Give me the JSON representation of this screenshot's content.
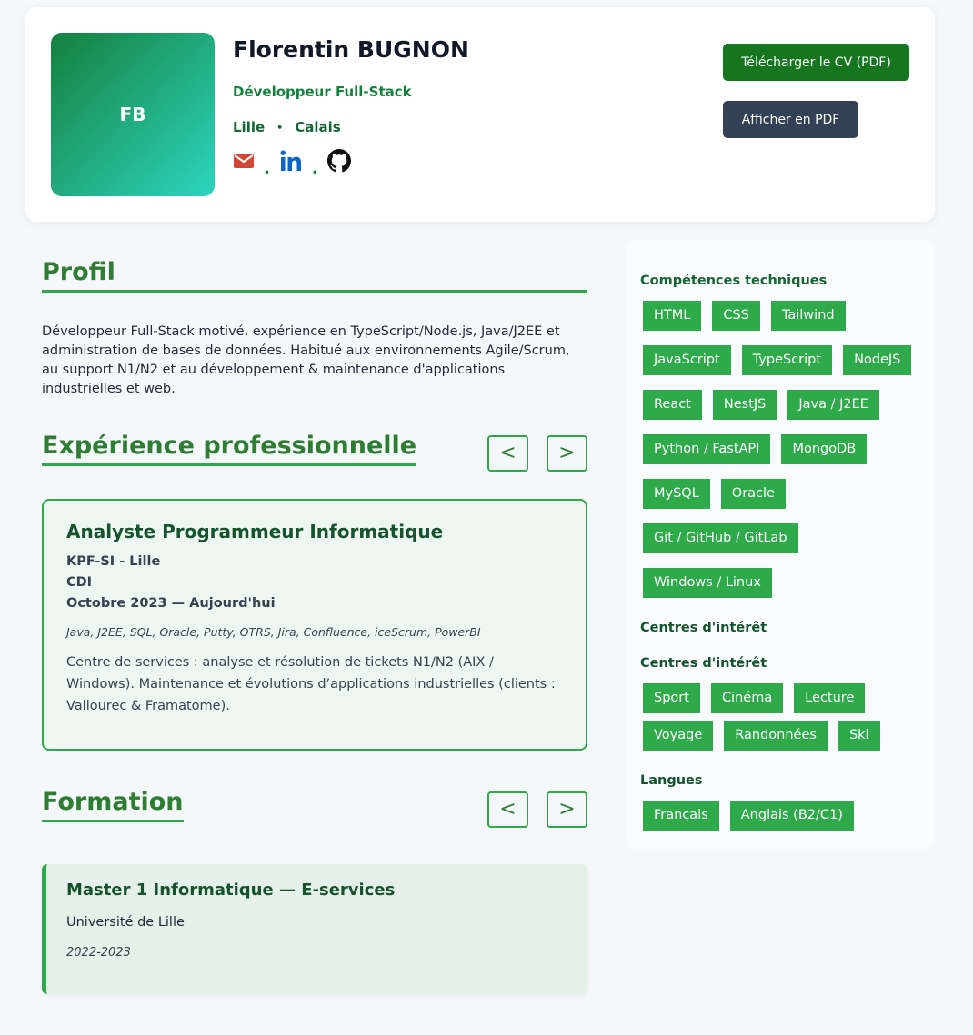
{
  "header": {
    "initials": "FB",
    "name": "Florentin BUGNON",
    "role": "Développeur Full-Stack",
    "locations": [
      "Lille",
      "Calais"
    ],
    "location_separator": "•",
    "social_separator": ".",
    "socials": [
      {
        "icon": "mail-icon",
        "color": "#d14836"
      },
      {
        "icon": "linkedin-icon",
        "color": "#0a66c2"
      },
      {
        "icon": "github-icon",
        "color": "#111111"
      }
    ],
    "download_button": "Télécharger le CV (PDF)",
    "pdf_button": "Afficher en PDF"
  },
  "profile": {
    "title": "Profil",
    "text": "Développeur Full-Stack motivé, expérience en TypeScript/Node.js, Java/J2EE et administration de bases de données. Habitué aux environnements Agile/Scrum, au support N1/N2 et au développement & maintenance d'applications industrielles et web."
  },
  "experience": {
    "title": "Expérience professionnelle",
    "prev_label": "<",
    "next_label": ">",
    "item": {
      "title": "Analyste Programmeur Informatique",
      "company": "KPF-SI - Lille",
      "contract": "CDI",
      "period": "Octobre 2023 — Aujourd'hui",
      "tech": "Java, J2EE, SQL, Oracle, Putty, OTRS, Jira, Confluence, iceScrum, PowerBI",
      "description": "Centre de services : analyse et résolution de tickets N1/N2 (AIX / Windows). Maintenance et évolutions d’applications industrielles (clients : Vallourec & Framatome)."
    }
  },
  "education": {
    "title": "Formation",
    "prev_label": "<",
    "next_label": ">",
    "item": {
      "title": "Master 1 Informatique — E-services",
      "school": "Université de Lille",
      "years": "2022-2023"
    }
  },
  "sidebar": {
    "skills_title": "Compétences techniques",
    "skills": [
      "HTML",
      "CSS",
      "Tailwind",
      "JavaScript",
      "TypeScript",
      "NodeJS",
      "React",
      "NestJS",
      "Java / J2EE",
      "Python / FastAPI",
      "MongoDB",
      "MySQL",
      "Oracle",
      "Git / GitHub / GitLab",
      "Windows / Linux"
    ],
    "interests_title_1": "Centres d'intérêt",
    "interests_title_2": "Centres d'intérêt",
    "interests": [
      "Sport",
      "Cinéma",
      "Lecture",
      "Voyage",
      "Randonnées",
      "Ski"
    ],
    "languages_title": "Langues",
    "languages": [
      "Français",
      "Anglais (B2/C1)"
    ]
  },
  "colors": {
    "accent": "#2eaa4a",
    "heading": "#2e7d32",
    "download_button": "#15761f",
    "pdf_button": "#334155"
  }
}
